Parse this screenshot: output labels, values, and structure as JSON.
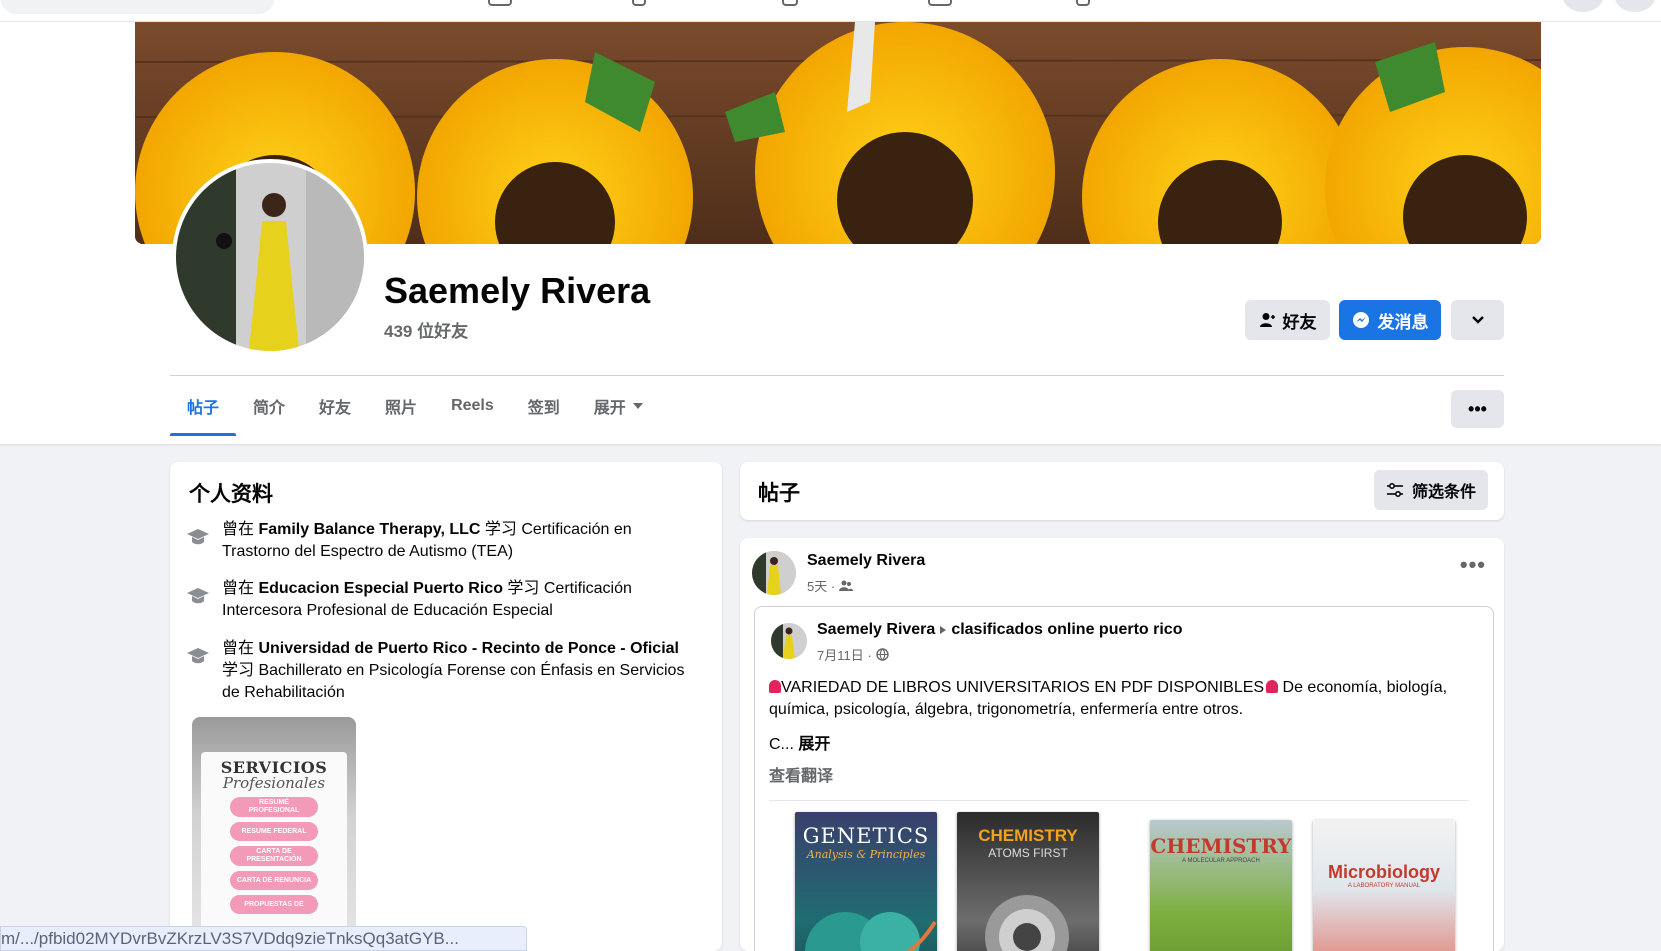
{
  "profile": {
    "name": "Saemely Rivera",
    "friends_count": "439 位好友"
  },
  "actions": {
    "friends_label": "好友",
    "message_label": "发消息"
  },
  "tabs": [
    {
      "label": "帖子",
      "active": true
    },
    {
      "label": "简介"
    },
    {
      "label": "好友"
    },
    {
      "label": "照片"
    },
    {
      "label": "Reels"
    },
    {
      "label": "签到"
    },
    {
      "label": "展开"
    }
  ],
  "intro": {
    "title": "个人资料",
    "items": [
      {
        "prefix": "曾在 ",
        "school": "Family Balance Therapy, LLC",
        "mid": " 学习 ",
        "detail": "Certificación en Trastorno del Espectro de Autismo (TEA)"
      },
      {
        "prefix": "曾在 ",
        "school": "Educacion Especial Puerto Rico",
        "mid": " 学习 ",
        "detail": "Certificación Intercesora Profesional de Educación Especial"
      },
      {
        "prefix": "曾在 ",
        "school": "Universidad de Puerto Rico - Recinto de Ponce - Oficial",
        "mid": " 学习 ",
        "detail": "Bachillerato en Psicología Forense con Énfasis en Servicios de Rehabilitación"
      }
    ],
    "featured": {
      "title": "SERVICIOS",
      "script": "Profesionales",
      "pills": [
        "RESUMÉ PROFESIONAL",
        "RESUME FEDERAL",
        "CARTA DE PRESENTACIÓN",
        "CARTA DE RENUNCIA",
        "PROPUESTAS DE"
      ]
    }
  },
  "posts_header": {
    "title": "帖子",
    "filter_label": "筛选条件"
  },
  "post": {
    "author": "Saemely Rivera",
    "time": "5天 ·",
    "shared": {
      "author": "Saemely Rivera",
      "group": "clasificados online puerto rico",
      "time": "7月11日 ·",
      "text_a": "VARIEDAD DE LIBROS UNIVERSITARIOS EN PDF DISPONIBLES",
      "text_b": " De economía, biología, química, psicología, álgebra, trigonometría, enfermería entre otros.",
      "truncated": "C...",
      "see_more": "展开",
      "translate": "查看翻译",
      "books": [
        {
          "title": "GENETICS",
          "subtitle": "Analysis & Principles"
        },
        {
          "title": "CHEMISTRY",
          "subtitle": "ATOMS FIRST"
        },
        {
          "title": "CHEMISTRY",
          "subtitle": "A MOLECULAR APPROACH"
        },
        {
          "title": "Microbiology",
          "subtitle": "A LABORATORY MANUAL"
        }
      ]
    }
  },
  "status_url": "m/.../pfbid02MYDvrBvZKrzLV3S7VDdq9zieTnksQq3atGYB..."
}
